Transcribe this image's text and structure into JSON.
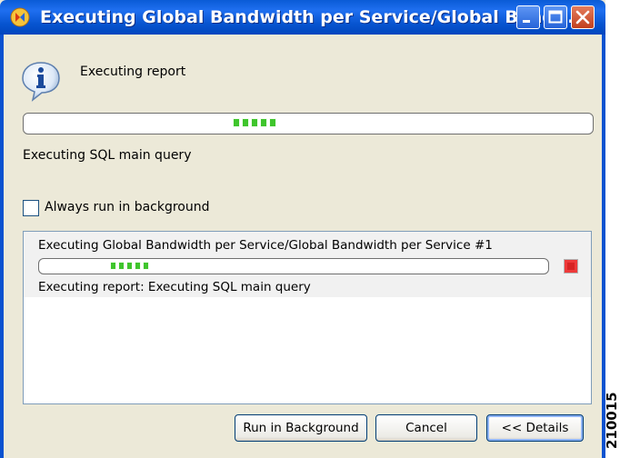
{
  "window": {
    "title": "Executing Global Bandwidth per Service/Global Band...",
    "icon": "app-icon",
    "controls": [
      "minimize-icon",
      "maximize-icon",
      "close-icon"
    ]
  },
  "status": {
    "icon": "info-icon",
    "label": "Executing report",
    "progress": "indeterminate",
    "detail": "Executing SQL main query"
  },
  "background_checkbox": {
    "label": "Always run in background",
    "checked": false
  },
  "job": {
    "title": "Executing Global Bandwidth per Service/Global Bandwidth per Service #1",
    "progress": "indeterminate",
    "status": "Executing report: Executing SQL main query",
    "stop_icon": "stop-icon"
  },
  "buttons": {
    "run_background": "Run in Background",
    "cancel": "Cancel",
    "details": "<< Details"
  },
  "side_label": "210015",
  "colors": {
    "titlebar": "#0a5bd6",
    "progress_chunk": "#3fc52c",
    "dialog_bg": "#ece9d8",
    "stop": "#ee3a3a"
  }
}
